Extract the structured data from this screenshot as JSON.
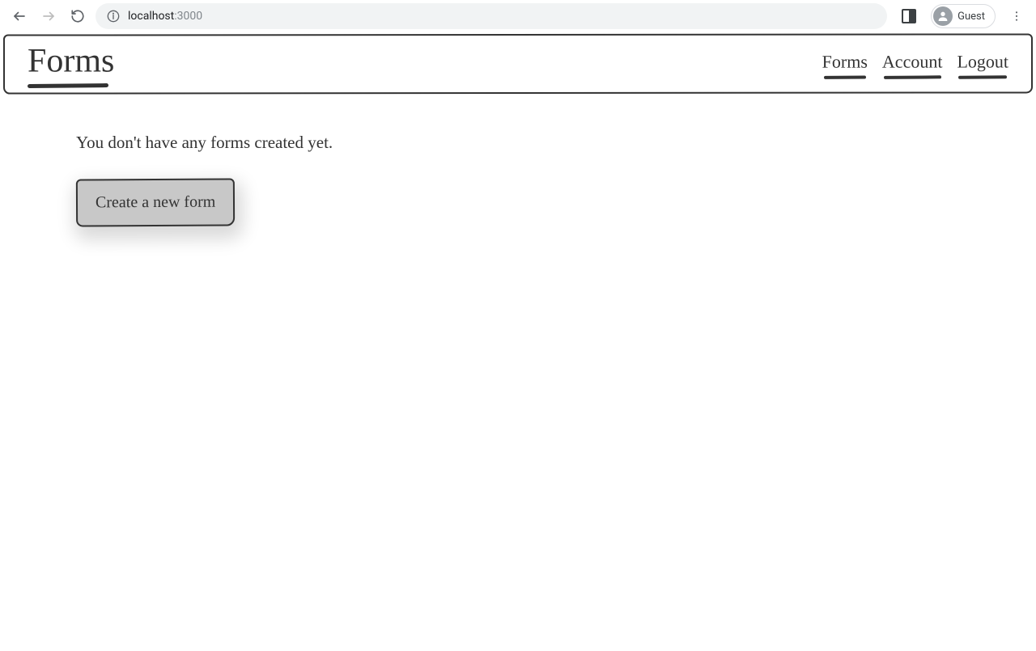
{
  "browser": {
    "url_host": "localhost",
    "url_port": ":3000",
    "guest_label": "Guest"
  },
  "header": {
    "title": "Forms",
    "nav": [
      {
        "label": "Forms"
      },
      {
        "label": "Account"
      },
      {
        "label": "Logout"
      }
    ]
  },
  "main": {
    "empty_message": "You don't have any forms created yet.",
    "create_button_label": "Create a new form"
  }
}
